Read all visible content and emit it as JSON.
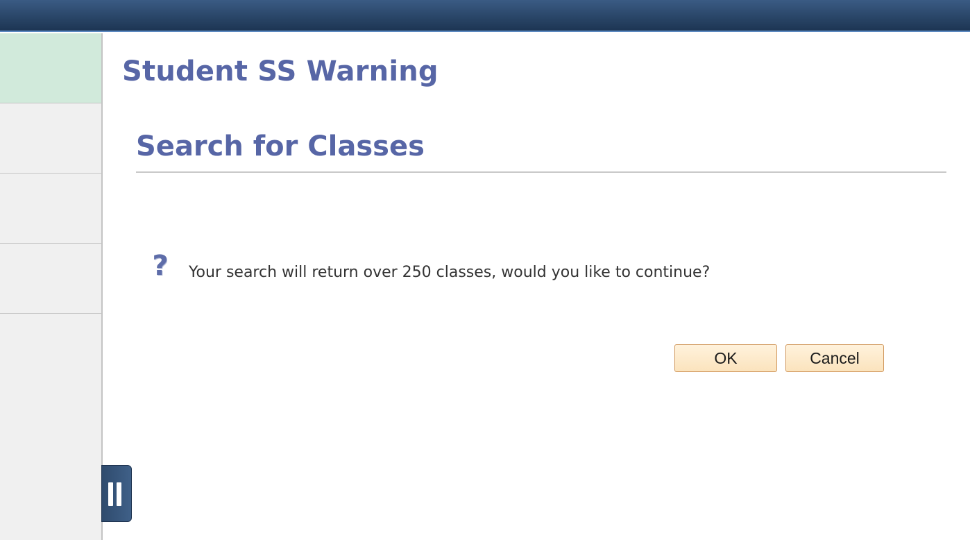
{
  "header": {
    "brand_color": "#2a4668"
  },
  "sidebar": {
    "items": [
      {
        "label": "",
        "active": true
      },
      {
        "label": "",
        "active": false
      },
      {
        "label": "",
        "active": false
      },
      {
        "label": "",
        "active": false
      }
    ],
    "collapse_icon": "pause-bars-icon"
  },
  "page": {
    "title": "Student SS Warning",
    "section_title": "Search for Classes"
  },
  "dialog": {
    "icon": "question-mark-icon",
    "icon_glyph": "?",
    "message": "Your search will return over 250 classes, would you like to continue?",
    "ok_label": "OK",
    "cancel_label": "Cancel"
  },
  "colors": {
    "title": "#5766a6",
    "active_sidebar": "#d1eadb",
    "button_bg": "#fbe3bd",
    "button_border": "#d29a60"
  }
}
